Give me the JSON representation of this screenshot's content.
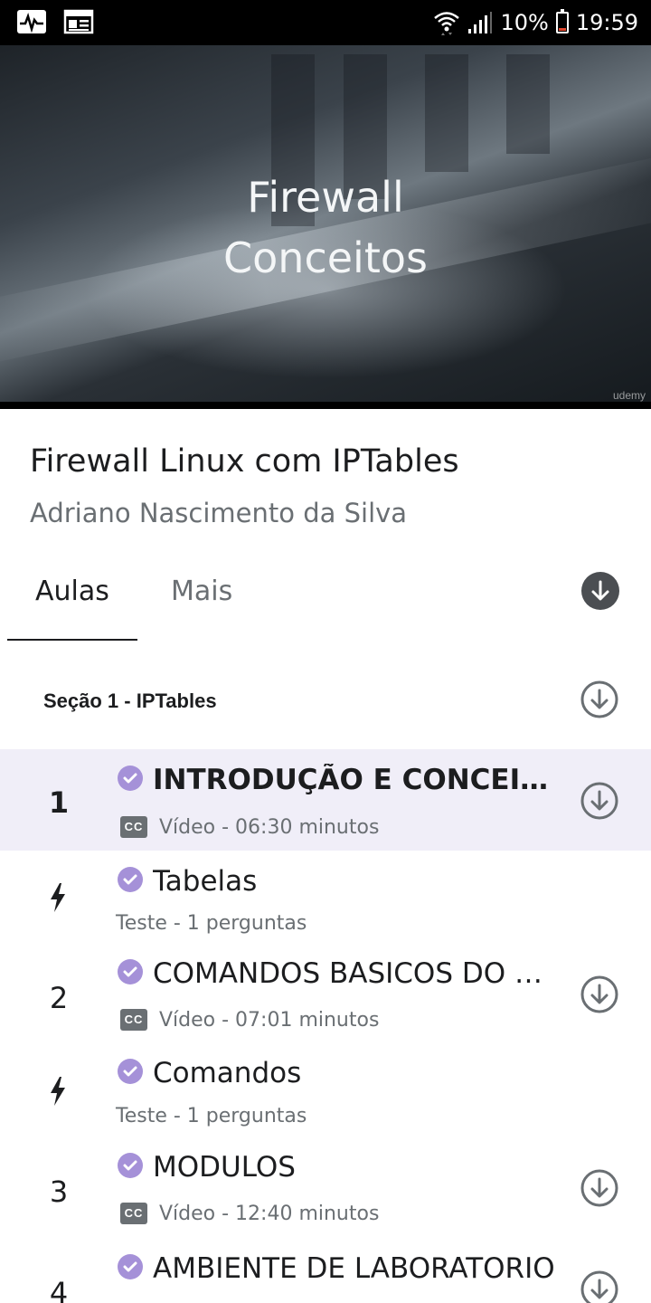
{
  "status_bar": {
    "left_icons": [
      "activity-monitor-icon",
      "news-feed-icon"
    ],
    "battery_percent": "10%",
    "time": "19:59",
    "right_icons": [
      "wifi-icon",
      "signal-icon",
      "battery-icon"
    ]
  },
  "video": {
    "title_line1": "Firewall",
    "title_line2": "Conceitos",
    "watermark": "udemy"
  },
  "course": {
    "title": "Firewall Linux com IPTables",
    "author": "Adriano Nascimento da Silva"
  },
  "tabs": {
    "items": [
      {
        "label": "Aulas",
        "selected": true
      },
      {
        "label": "Mais",
        "selected": false
      }
    ]
  },
  "section": {
    "title": "Seção 1 - IPTables"
  },
  "lessons": [
    {
      "index": "1",
      "kind": "video",
      "title": "INTRODUÇÃO E CONCEITOS",
      "meta": "Vídeo - 06:30 minutos",
      "completed": true,
      "active": true,
      "downloadable": true
    },
    {
      "index": "",
      "kind": "test",
      "title": "Tabelas",
      "meta": "Teste - 1 perguntas",
      "completed": true,
      "active": false,
      "downloadable": false
    },
    {
      "index": "2",
      "kind": "video",
      "title": "COMANDOS BASICOS DO IPTABLES",
      "meta": "Vídeo - 07:01 minutos",
      "completed": true,
      "active": false,
      "downloadable": true
    },
    {
      "index": "",
      "kind": "test",
      "title": "Comandos",
      "meta": "Teste - 1 perguntas",
      "completed": true,
      "active": false,
      "downloadable": false
    },
    {
      "index": "3",
      "kind": "video",
      "title": "MODULOS",
      "meta": "Vídeo - 12:40 minutos",
      "completed": true,
      "active": false,
      "downloadable": true
    },
    {
      "index": "4",
      "kind": "video",
      "title": "AMBIENTE DE LABORATORIO",
      "meta": "",
      "completed": true,
      "active": false,
      "downloadable": true
    }
  ],
  "labels": {
    "cc_badge": "CC"
  },
  "colors": {
    "accent_check": "#a591d8",
    "active_row_bg": "#f0eef8",
    "text_primary": "#1c1d1f",
    "text_secondary": "#6a6f73"
  }
}
